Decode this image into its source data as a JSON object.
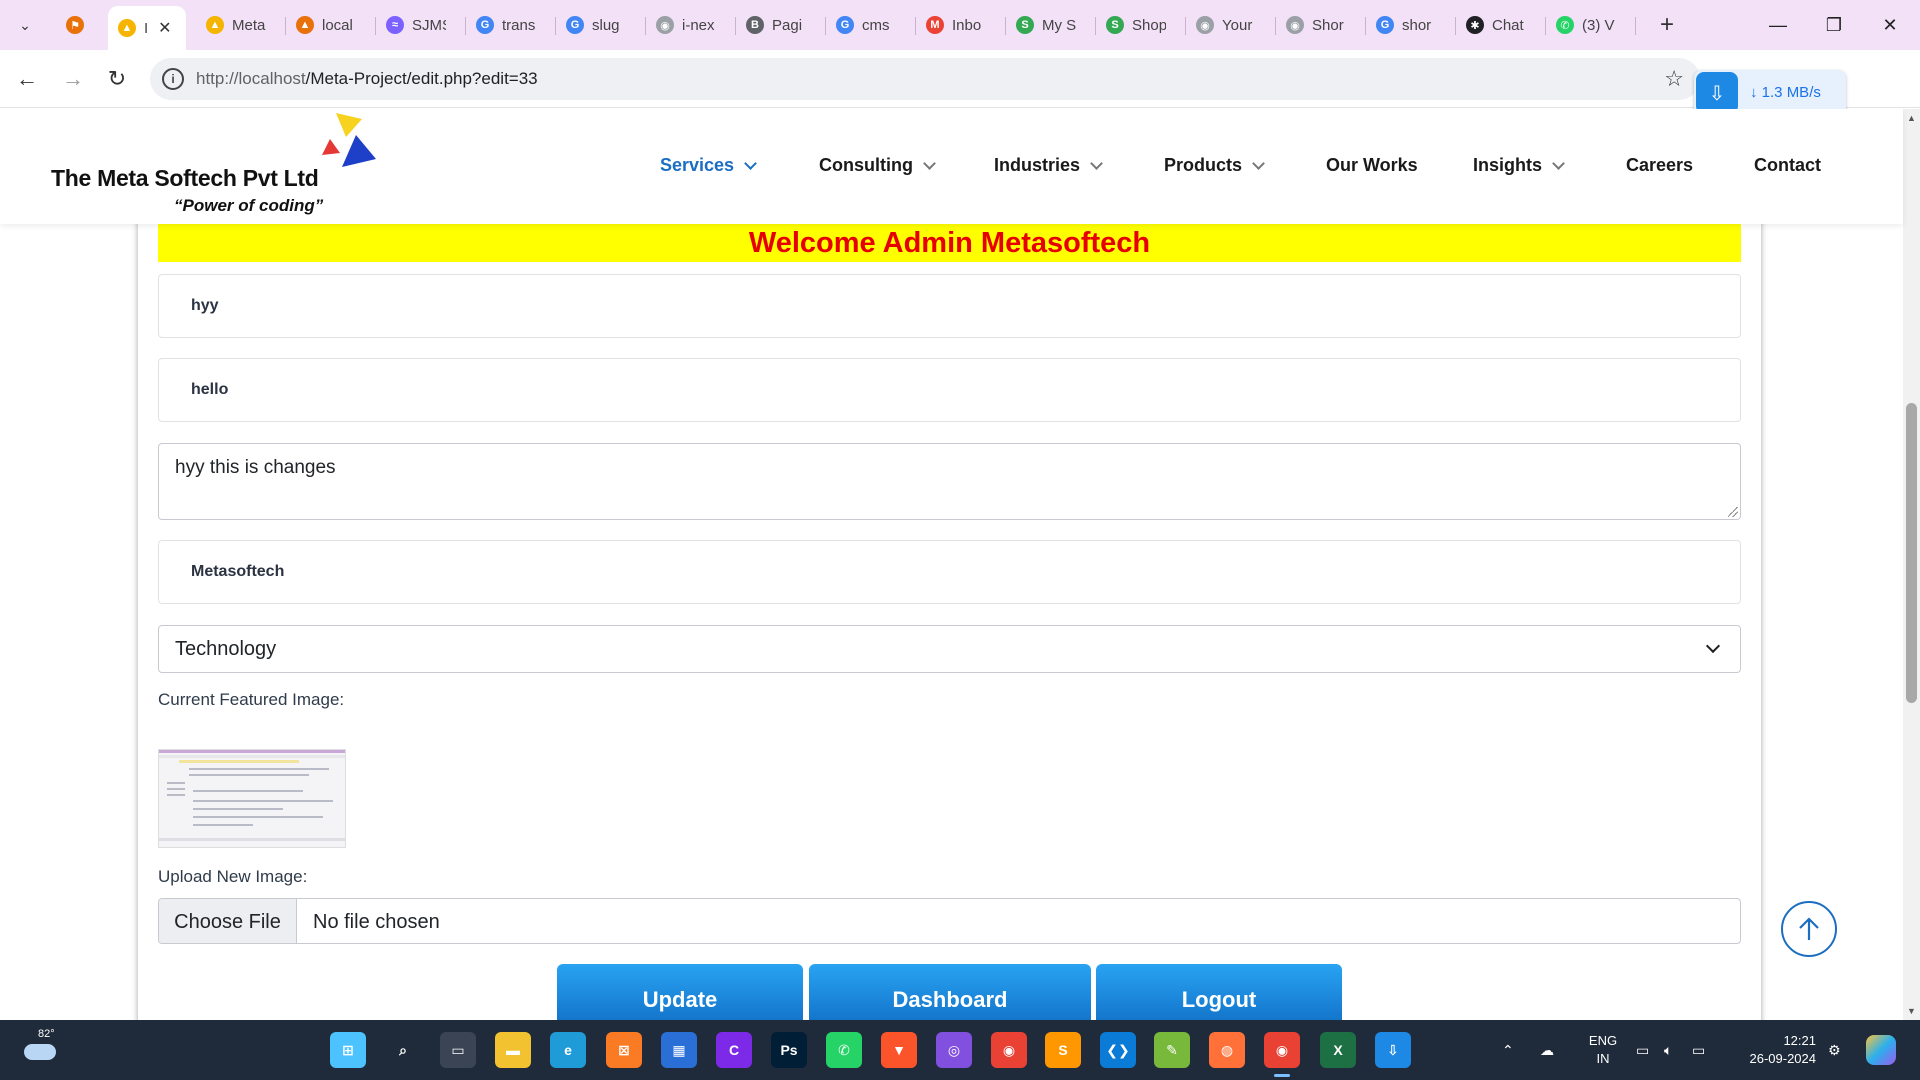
{
  "browser": {
    "tabs": [
      {
        "title": "Meta",
        "color": "#f4b400",
        "glyph": "▲"
      },
      {
        "title": "local",
        "color": "#e8710a",
        "glyph": "▲"
      },
      {
        "title": "SJMS",
        "color": "#7b61ff",
        "glyph": "≈"
      },
      {
        "title": "trans",
        "color": "#4285f4",
        "glyph": "G"
      },
      {
        "title": "slug",
        "color": "#4285f4",
        "glyph": "G"
      },
      {
        "title": "i-nex",
        "color": "#9aa0a6",
        "glyph": "◉"
      },
      {
        "title": "Pagi",
        "color": "#5f6368",
        "glyph": "B"
      },
      {
        "title": "cms",
        "color": "#4285f4",
        "glyph": "G"
      },
      {
        "title": "Inbo",
        "color": "#ea4335",
        "glyph": "M"
      },
      {
        "title": "My S",
        "color": "#34a853",
        "glyph": "S"
      },
      {
        "title": "Shop",
        "color": "#34a853",
        "glyph": "S"
      },
      {
        "title": "Your",
        "color": "#9aa0a6",
        "glyph": "◉"
      },
      {
        "title": "Shor",
        "color": "#9aa0a6",
        "glyph": "◉"
      },
      {
        "title": "shor",
        "color": "#4285f4",
        "glyph": "G"
      },
      {
        "title": "Chat",
        "color": "#202124",
        "glyph": "✱"
      },
      {
        "title": "(3) V",
        "color": "#25d366",
        "glyph": "✆"
      }
    ],
    "active_tab_title": "I",
    "url_host": "http://localhost",
    "url_path": "/Meta-Project/edit.php?edit=33",
    "download_speed": "1.3 MB/s"
  },
  "site": {
    "logo_name": "The Meta Softech Pvt Ltd",
    "logo_tagline": "“Power of coding”",
    "nav": [
      {
        "label": "Services",
        "dropdown": true,
        "active": true
      },
      {
        "label": "Consulting",
        "dropdown": true
      },
      {
        "label": "Industries",
        "dropdown": true
      },
      {
        "label": "Products",
        "dropdown": true
      },
      {
        "label": "Our Works",
        "dropdown": false
      },
      {
        "label": "Insights",
        "dropdown": true
      },
      {
        "label": "Careers",
        "dropdown": false
      },
      {
        "label": "Contact",
        "dropdown": false
      }
    ]
  },
  "form": {
    "welcome": "Welcome Admin Metasoftech",
    "field_title": "hyy",
    "field_subtitle": "hello",
    "content_textarea": "hyy this is changes",
    "field_author": "Metasoftech",
    "category_selected": "Technology",
    "current_image_label": "Current Featured Image:",
    "upload_label": "Upload New Image:",
    "choose_file": "Choose File",
    "no_file": "No file chosen",
    "buttons": {
      "update": "Update",
      "dashboard": "Dashboard",
      "logout": "Logout"
    }
  },
  "taskbar": {
    "temperature": "82°",
    "lang_line1": "ENG",
    "lang_line2": "IN",
    "time": "12:21",
    "date": "26-09-2024",
    "apps": [
      {
        "name": "windows-start",
        "color": "#4cc2ff",
        "glyph": "⊞"
      },
      {
        "name": "search",
        "color": "transparent",
        "glyph": "⌕"
      },
      {
        "name": "task-view",
        "color": "#3a4455",
        "glyph": "▭"
      },
      {
        "name": "file-explorer",
        "color": "#f2c230",
        "glyph": "▬"
      },
      {
        "name": "edge",
        "color": "#1f9bd7",
        "glyph": "e"
      },
      {
        "name": "xampp",
        "color": "#fb7a24",
        "glyph": "⊠"
      },
      {
        "name": "store",
        "color": "#2a6fd6",
        "glyph": "▦"
      },
      {
        "name": "canva",
        "color": "#7d2ae8",
        "glyph": "C"
      },
      {
        "name": "photoshop",
        "color": "#001e36",
        "glyph": "Ps"
      },
      {
        "name": "whatsapp",
        "color": "#25d366",
        "glyph": "✆"
      },
      {
        "name": "brave",
        "color": "#fb542b",
        "glyph": "▼"
      },
      {
        "name": "github",
        "color": "#8250df",
        "glyph": "◎"
      },
      {
        "name": "chrome",
        "color": "#e94235",
        "glyph": "◉"
      },
      {
        "name": "sublime",
        "color": "#ff9800",
        "glyph": "S"
      },
      {
        "name": "vscode",
        "color": "#0a7bd6",
        "glyph": "❮❯"
      },
      {
        "name": "notepad",
        "color": "#78b83a",
        "glyph": "✎"
      },
      {
        "name": "firefox",
        "color": "#ff7139",
        "glyph": "◍"
      },
      {
        "name": "chrome-active",
        "color": "#e94235",
        "glyph": "◉"
      },
      {
        "name": "excel",
        "color": "#1d7044",
        "glyph": "X"
      },
      {
        "name": "downloader",
        "color": "#1e88e5",
        "glyph": "⇩"
      }
    ]
  }
}
